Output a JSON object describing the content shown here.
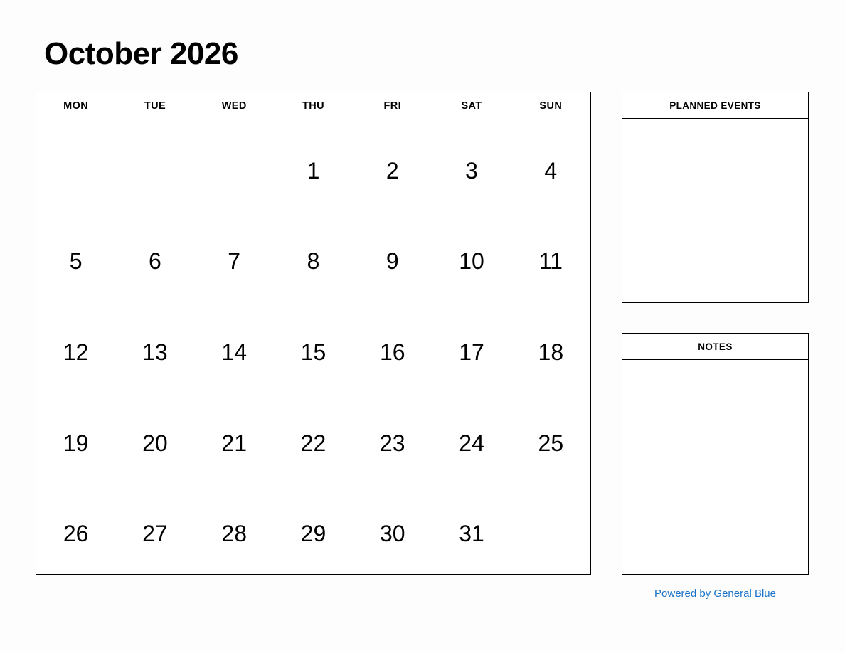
{
  "document": {
    "title": "October 2026",
    "month": "October",
    "year": "2026"
  },
  "calendar": {
    "weekday_headers": [
      "MON",
      "TUE",
      "WED",
      "THU",
      "FRI",
      "SAT",
      "SUN"
    ],
    "week_start": "MON",
    "weeks": [
      [
        "",
        "",
        "",
        "1",
        "2",
        "3",
        "4"
      ],
      [
        "5",
        "6",
        "7",
        "8",
        "9",
        "10",
        "11"
      ],
      [
        "12",
        "13",
        "14",
        "15",
        "16",
        "17",
        "18"
      ],
      [
        "19",
        "20",
        "21",
        "22",
        "23",
        "24",
        "25"
      ],
      [
        "26",
        "27",
        "28",
        "29",
        "30",
        "31",
        ""
      ]
    ]
  },
  "panels": {
    "planned_events": {
      "header": "PLANNED EVENTS",
      "body": ""
    },
    "notes": {
      "header": "NOTES",
      "body": ""
    }
  },
  "footer": {
    "link_text": "Powered by General Blue",
    "link_color": "#1a73c8"
  },
  "colors": {
    "page_background": "#fdfdfd",
    "panel_background": "#ffffff",
    "border": "#000000",
    "text": "#000000",
    "link": "#1a73c8"
  }
}
